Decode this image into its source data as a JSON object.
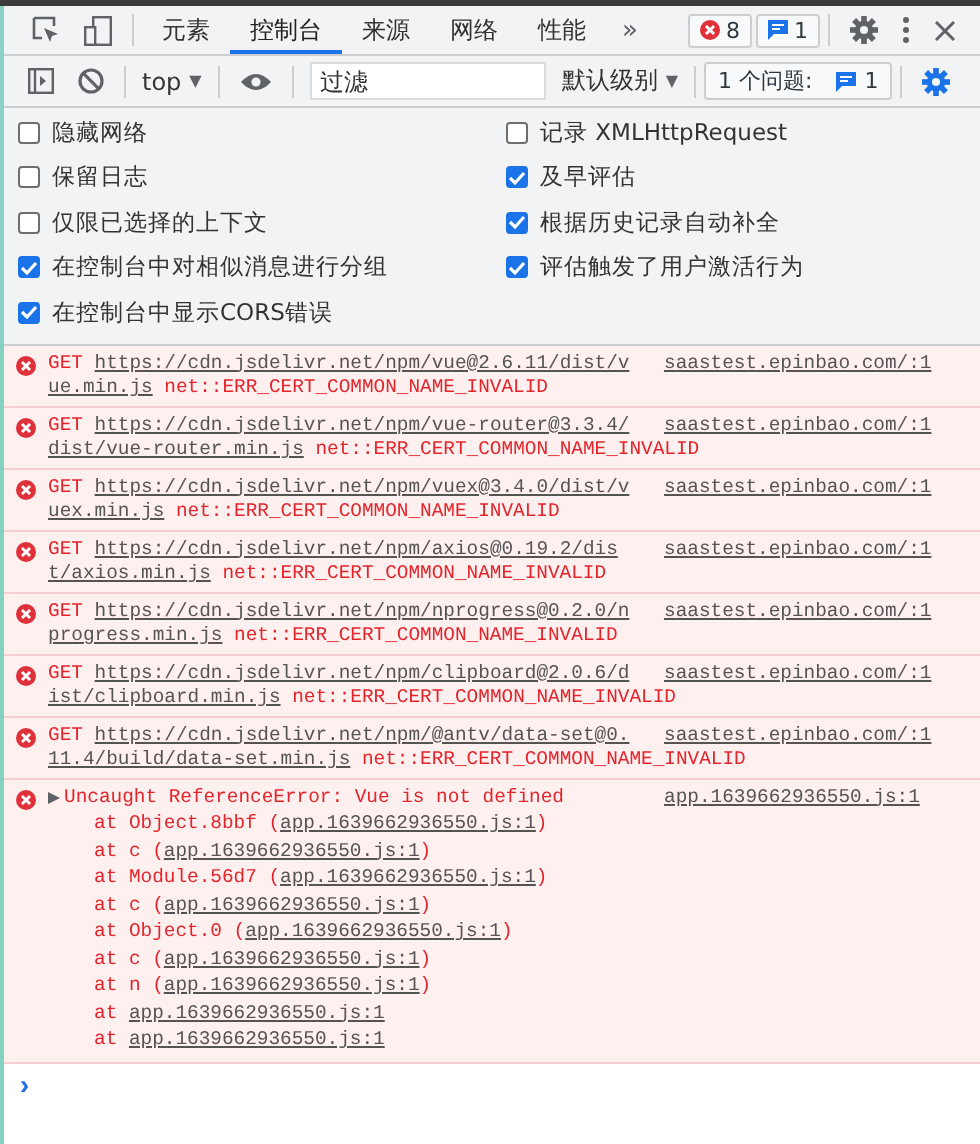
{
  "main_tabs": [
    {
      "label": "元素",
      "selected": false
    },
    {
      "label": "控制台",
      "selected": true
    },
    {
      "label": "来源",
      "selected": false
    },
    {
      "label": "网络",
      "selected": false
    },
    {
      "label": "性能",
      "selected": false
    }
  ],
  "more_tabs": "»",
  "error_count": "8",
  "info_count": "1",
  "context": {
    "label": "top",
    "caret": "▼"
  },
  "filter": {
    "placeholder": "过滤"
  },
  "level_menu": {
    "label": "默认级别",
    "caret": "▼"
  },
  "issues": {
    "label": "1 个问题:",
    "count": "1"
  },
  "settings": [
    {
      "label": "隐藏网络",
      "checked": false
    },
    {
      "label": "记录 XMLHttpRequest",
      "checked": false
    },
    {
      "label": "保留日志",
      "checked": false
    },
    {
      "label": "及早评估",
      "checked": true
    },
    {
      "label": "仅限已选择的上下文",
      "checked": false
    },
    {
      "label": "根据历史记录自动补全",
      "checked": true
    },
    {
      "label": "在控制台中对相似消息进行分组",
      "checked": true
    },
    {
      "label": "评估触发了用户激活行为",
      "checked": true
    },
    {
      "label": "在控制台中显示CORS错误",
      "checked": true
    }
  ],
  "messages": [
    {
      "method": "GET",
      "url_parts": [
        "https://cdn.jsdelivr.net/npm/vue@2.6.11/dist/v",
        "ue.min.js"
      ],
      "error": "net::ERR_CERT_COMMON_NAME_INVALID",
      "source": "saastest.epinbao.com/:1"
    },
    {
      "method": "GET",
      "url_parts": [
        "https://cdn.jsdelivr.net/npm/vue-router@3.3.4/",
        "dist/vue-router.min.js"
      ],
      "error": "net::ERR_CERT_COMMON_NAME_INVALID",
      "source": "saastest.epinbao.com/:1"
    },
    {
      "method": "GET",
      "url_parts": [
        "https://cdn.jsdelivr.net/npm/vuex@3.4.0/dist/v",
        "uex.min.js"
      ],
      "error": "net::ERR_CERT_COMMON_NAME_INVALID",
      "source": "saastest.epinbao.com/:1"
    },
    {
      "method": "GET",
      "url_parts": [
        "https://cdn.jsdelivr.net/npm/axios@0.19.2/dis",
        "t/axios.min.js"
      ],
      "error": "net::ERR_CERT_COMMON_NAME_INVALID",
      "source": "saastest.epinbao.com/:1"
    },
    {
      "method": "GET",
      "url_parts": [
        "https://cdn.jsdelivr.net/npm/nprogress@0.2.0/n",
        "progress.min.js"
      ],
      "error": "net::ERR_CERT_COMMON_NAME_INVALID",
      "source": "saastest.epinbao.com/:1"
    },
    {
      "method": "GET",
      "url_parts": [
        "https://cdn.jsdelivr.net/npm/clipboard@2.0.6/d",
        "ist/clipboard.min.js"
      ],
      "error": "net::ERR_CERT_COMMON_NAME_INVALID",
      "source": "saastest.epinbao.com/:1"
    },
    {
      "method": "GET",
      "url_parts": [
        "https://cdn.jsdelivr.net/npm/@antv/data-set@0.",
        "11.4/build/data-set.min.js"
      ],
      "error": "net::ERR_CERT_COMMON_NAME_INVALID",
      "source": "saastest.epinbao.com/:1"
    }
  ],
  "exception": {
    "message": "Uncaught ReferenceError: Vue is not defined",
    "expanded": true,
    "source": "app.1639662936550.js:1",
    "frames": [
      {
        "prefix": "at Object.8bbf (",
        "link": "app.1639662936550.js:1",
        "suffix": ")"
      },
      {
        "prefix": "at c (",
        "link": "app.1639662936550.js:1",
        "suffix": ")"
      },
      {
        "prefix": "at Module.56d7 (",
        "link": "app.1639662936550.js:1",
        "suffix": ")"
      },
      {
        "prefix": "at c (",
        "link": "app.1639662936550.js:1",
        "suffix": ")"
      },
      {
        "prefix": "at Object.0 (",
        "link": "app.1639662936550.js:1",
        "suffix": ")"
      },
      {
        "prefix": "at c (",
        "link": "app.1639662936550.js:1",
        "suffix": ")"
      },
      {
        "prefix": "at n (",
        "link": "app.1639662936550.js:1",
        "suffix": ")"
      },
      {
        "prefix": "at ",
        "link": "app.1639662936550.js:1"
      },
      {
        "prefix": "at ",
        "link": "app.1639662936550.js:1"
      }
    ]
  },
  "prompt": "›"
}
